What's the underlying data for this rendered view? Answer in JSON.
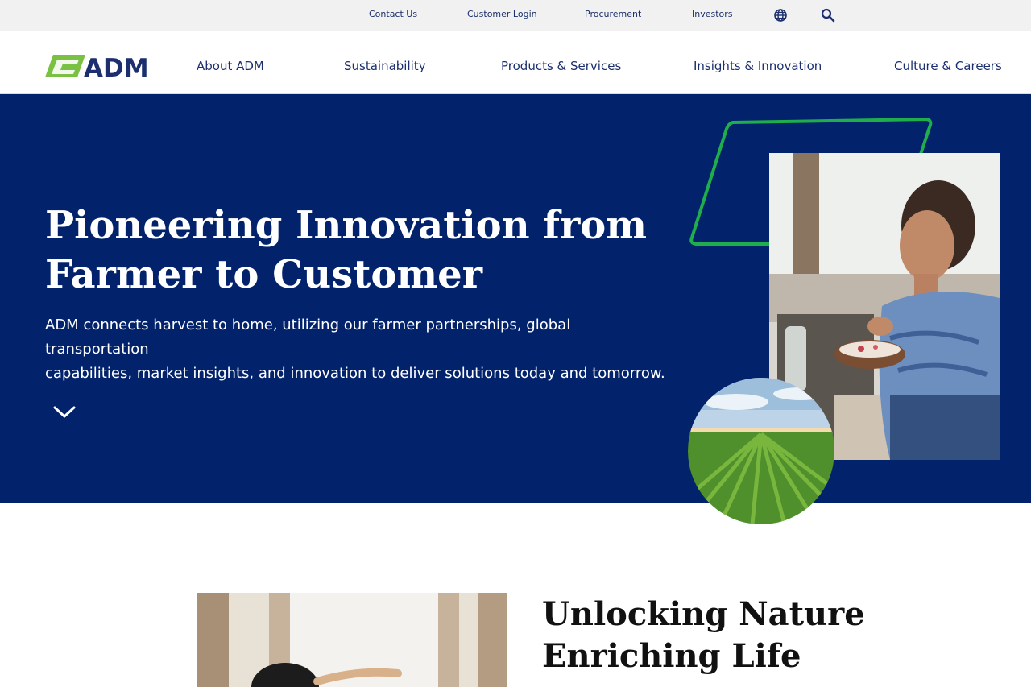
{
  "utility_nav": {
    "contact_us": "Contact Us",
    "customer_login": "Customer Login",
    "procurement": "Procurement",
    "investors": "Investors",
    "icons": [
      "globe-icon",
      "search-icon"
    ]
  },
  "logo": {
    "text": "ADM"
  },
  "main_nav": {
    "items": [
      {
        "label": "About ADM"
      },
      {
        "label": "Sustainability"
      },
      {
        "label": "Products & Services"
      },
      {
        "label": "Insights & Innovation"
      },
      {
        "label": "Culture & Careers"
      }
    ]
  },
  "hero": {
    "title_line1": "Pioneering Innovation from",
    "title_line2": "Farmer to Customer",
    "copy_line1": "ADM connects harvest to home, utilizing our farmer partnerships, global transportation",
    "copy_line2": "capabilities, market insights, and innovation to deliver solutions today and tomorrow.",
    "scroll_icon": "chevron-down-icon"
  },
  "section": {
    "title_line1": "Unlocking Nature",
    "title_line2": "Enriching Life"
  },
  "colors": {
    "hero_background": "#02226b",
    "brand_navy": "#1b2f6e",
    "brand_green": "#1fae4b",
    "logo_green": "#7ac143",
    "utility_bar": "#f1f1f1"
  }
}
